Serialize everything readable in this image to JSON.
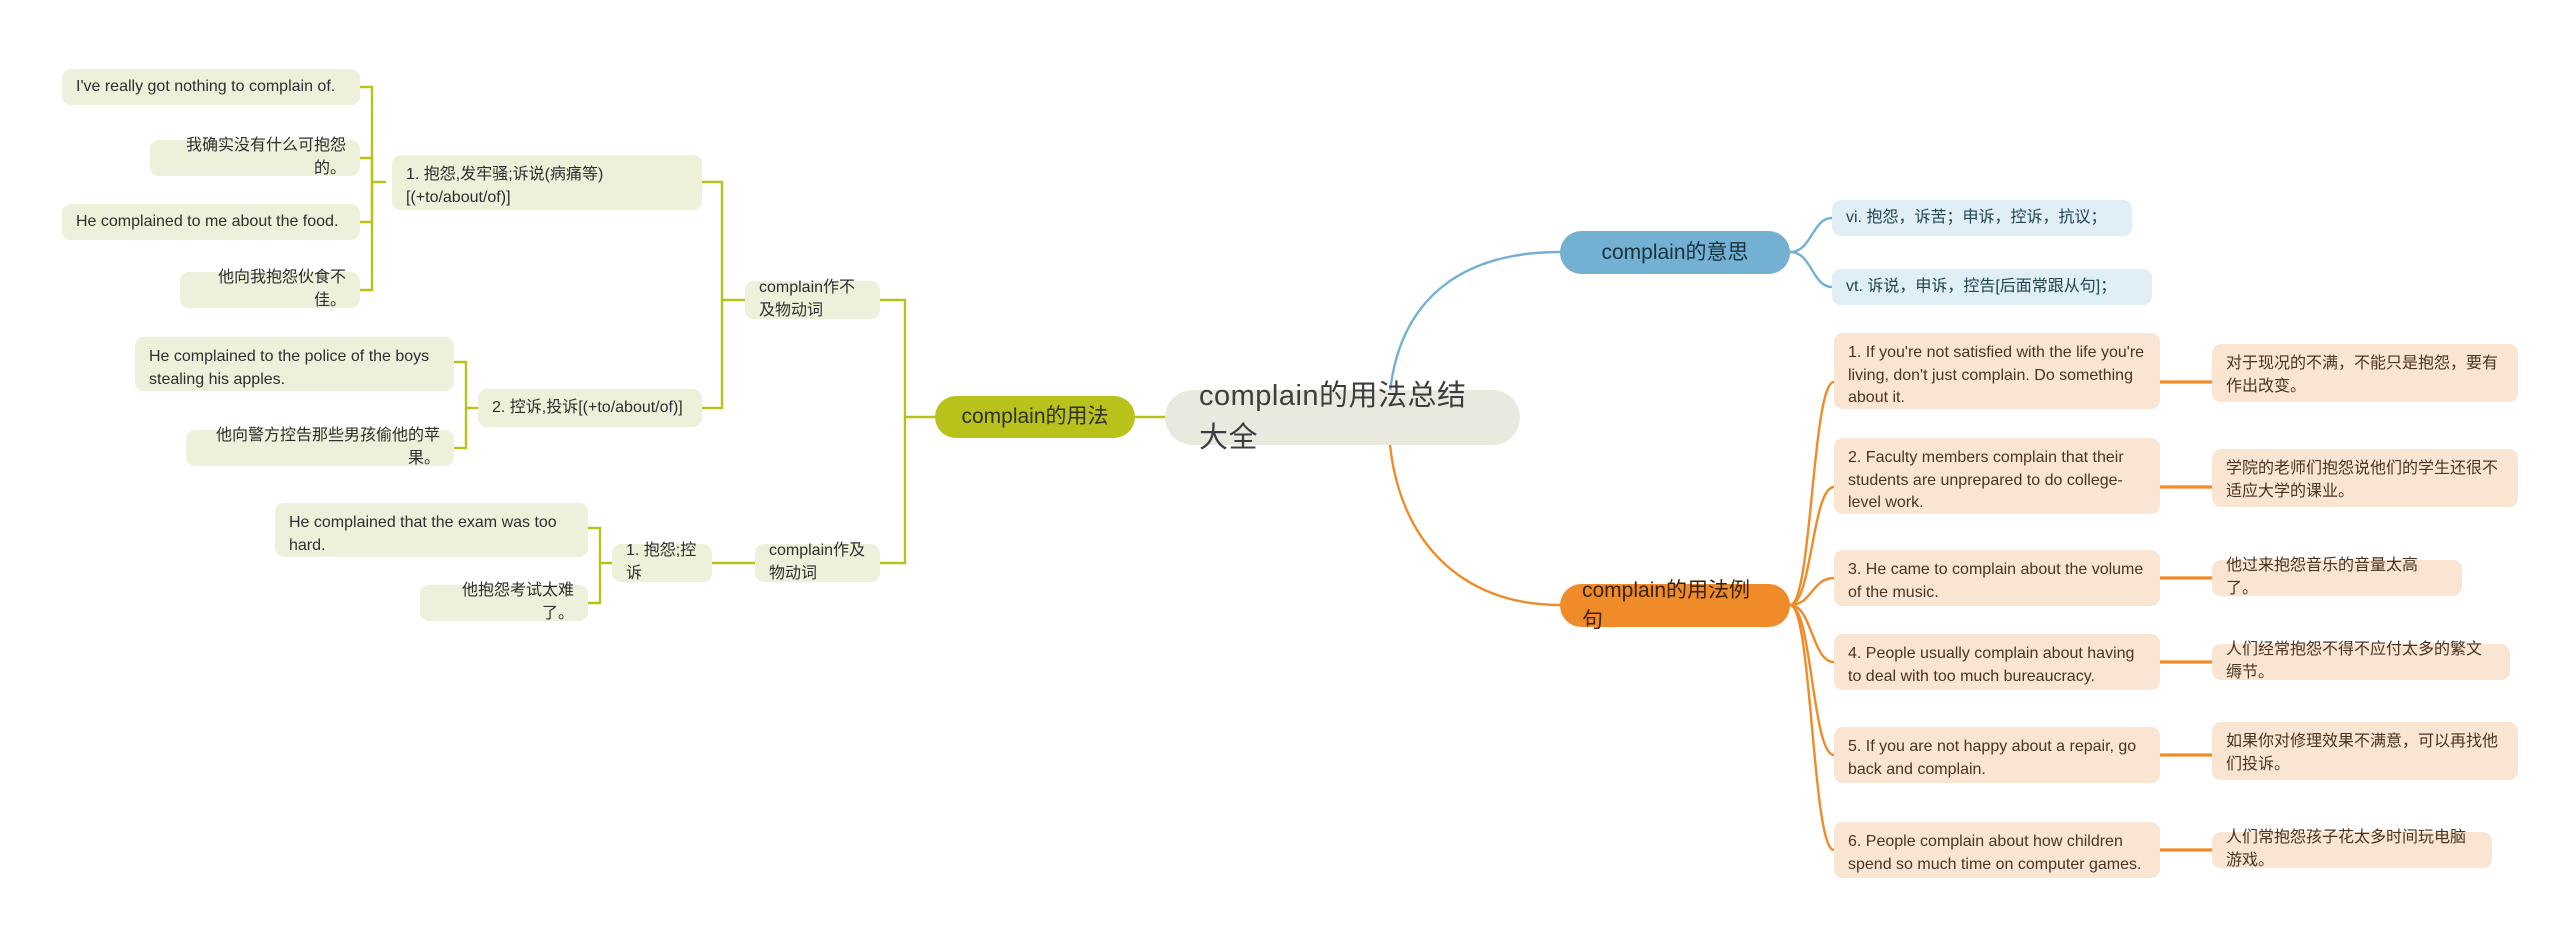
{
  "root": {
    "label": "complain的用法总结大全"
  },
  "colors": {
    "root_bg": "#e9e9e0",
    "green": "#b9c21a",
    "blue": "#74b0d1",
    "orange": "#ef8b28",
    "green_leaf_bg": "#eff0db",
    "blue_leaf_bg": "#e0eef6",
    "orange_leaf_bg": "#fae5d3",
    "green_line": "#b9c21a",
    "blue_line": "#74b0d1",
    "orange_line": "#ef8b28"
  },
  "branches": {
    "usage": {
      "label": "complain的用法",
      "children": [
        {
          "label": "complain作不及物动词",
          "senses": [
            {
              "label": "1. 抱怨,发牢骚;诉说(病痛等)[(+to/about/of)]",
              "examples": [
                {
                  "en": "I've really got nothing to complain of.",
                  "zh": "我确实没有什么可抱怨的。"
                },
                {
                  "en": "He complained to me about the food.",
                  "zh": "他向我抱怨伙食不佳。"
                }
              ]
            },
            {
              "label": "2. 控诉,投诉[(+to/about/of)]",
              "examples": [
                {
                  "en": "He complained to the police of the boys stealing his apples.",
                  "zh": "他向警方控告那些男孩偷他的苹果。"
                }
              ]
            }
          ]
        },
        {
          "label": "complain作及物动词",
          "senses": [
            {
              "label": "1. 抱怨;控诉",
              "examples": [
                {
                  "en": "He complained that the exam was too hard.",
                  "zh": "他抱怨考试太难了。"
                }
              ]
            }
          ]
        }
      ]
    },
    "meaning": {
      "label": "complain的意思",
      "items": [
        "vi. 抱怨，诉苦；申诉，控诉，抗议；",
        "vt. 诉说，申诉，控告[后面常跟从句]；"
      ]
    },
    "sentences": {
      "label": "complain的用法例句",
      "items": [
        {
          "en": "1. If you're not satisfied with the life you're living, don't just complain. Do something about it.",
          "zh": "对于现况的不满，不能只是抱怨，要有作出改变。"
        },
        {
          "en": "2. Faculty members complain that their students are unprepared to do college-level work.",
          "zh": "学院的老师们抱怨说他们的学生还很不适应大学的课业。"
        },
        {
          "en": "3. He came to complain about the volume of the music.",
          "zh": "他过来抱怨音乐的音量太高了。"
        },
        {
          "en": "4. People usually complain about having to deal with too much bureaucracy.",
          "zh": "人们经常抱怨不得不应付太多的繁文缛节。"
        },
        {
          "en": "5. If you are not happy about a repair, go back and complain.",
          "zh": "如果你对修理效果不满意，可以再找他们投诉。"
        },
        {
          "en": "6. People complain about how children spend so much time on computer games.",
          "zh": "人们常抱怨孩子花太多时间玩电脑游戏。"
        }
      ]
    }
  }
}
